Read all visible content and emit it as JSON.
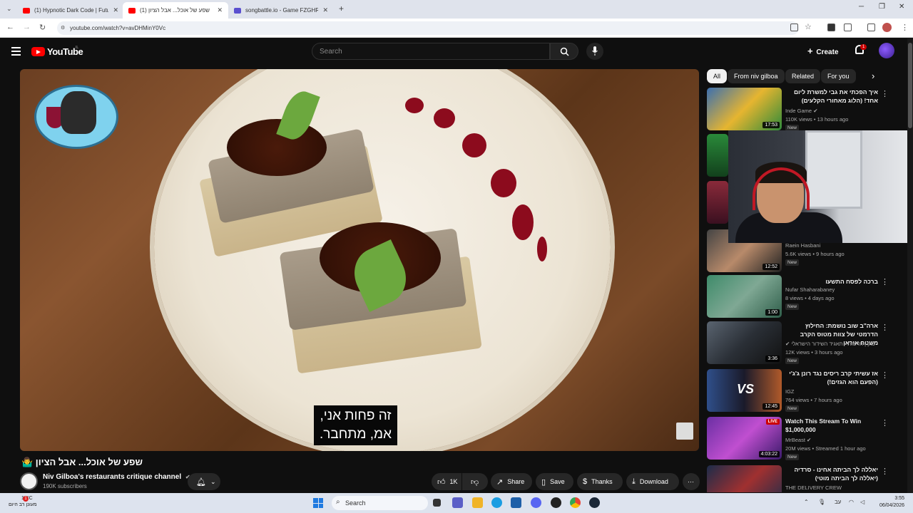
{
  "browser": {
    "tabs": [
      {
        "title": "(1) Hypnotic Dark Code | Futur",
        "favicon_color": "#ff0000"
      },
      {
        "title": "(1) שפע של אוכל... אבל הציון",
        "favicon_color": "#ff0000"
      },
      {
        "title": "songbattle.io - Game FZGHR",
        "favicon_color": "#5a4fcf"
      }
    ],
    "url": "youtube.com/watch?v=avDHMinY0Vc"
  },
  "youtube": {
    "logo_text": "YouTube",
    "country_code": "IL",
    "search_placeholder": "Search",
    "create_label": "Create",
    "notification_count": "1"
  },
  "video": {
    "subtitle_line1": "זה פחות אני,",
    "subtitle_line2": "אמ, מתחבר.",
    "title": "שפע של אוכל... אבל הציון 🤷‍♂️",
    "channel_name": "Niv Gilboa's restaurants critique channel",
    "subscribers": "190K subscribers",
    "like_count": "1K",
    "share_label": "Share",
    "save_label": "Save",
    "thanks_label": "Thanks",
    "download_label": "Download"
  },
  "chips": [
    "All",
    "From niv gilboa",
    "Related",
    "For you"
  ],
  "recommendations": [
    {
      "title": "איך הפכתי את גבי למשרת ליום אחד! (הלוג מאחורי הקלעים)",
      "channel": "Inde Game",
      "meta": "110K views • 13 hours ago",
      "duration": "17:53",
      "new": "New",
      "thumb": "#3b6fb0"
    },
    {
      "title": "",
      "channel": "Raein Hasbani",
      "meta": "5.6K views • 9 hours ago",
      "duration": "12:52",
      "new": "New",
      "thumb": "#2c2c2c"
    },
    {
      "title": "ברכה לפסח התשעו",
      "channel": "Nufar Shaharabaney",
      "meta": "8 views • 4 days ago",
      "duration": "1:00",
      "new": "New",
      "thumb": "#3e8b6a"
    },
    {
      "title": "ארה\"ב שוב נושמת: החילוץ הדרמטי של צוות מטוס הקרב משטח איראן",
      "channel": "כאן | חדשות - תאגיד השידור הישראלי",
      "meta": "12K views • 3 hours ago",
      "duration": "3:36",
      "new": "New",
      "thumb": "#3a3f47"
    },
    {
      "title": "אז עשיתי קרב ריסים נגד רונן ג'ג'י (הפעם הוא הגזים!)",
      "channel": "IGZ",
      "meta": "764 views • 7 hours ago",
      "duration": "12:45",
      "new": "New",
      "thumb": "#2f4f8a"
    },
    {
      "title": "Watch This Stream To Win $1,000,000",
      "channel": "MrBeast",
      "meta": "20M views • Streamed 1 hour ago",
      "duration": "4:03:22",
      "new": "New",
      "thumb": "#6a2fa3"
    },
    {
      "title": "יאללה לך הביתה אחינו - סרדיה (יאללה לך הביתה מוטי)",
      "channel": "THE DELIVERY CREW",
      "meta": "",
      "duration": "",
      "new": "",
      "thumb": "#1c2c4a"
    }
  ],
  "taskbar": {
    "weather_temp": "13°C",
    "weather_desc": "מעונן רב היום",
    "search_label": "Search",
    "lang": "עב",
    "time": "3:55",
    "date": "06/04/2026",
    "weather_badge": "1"
  }
}
